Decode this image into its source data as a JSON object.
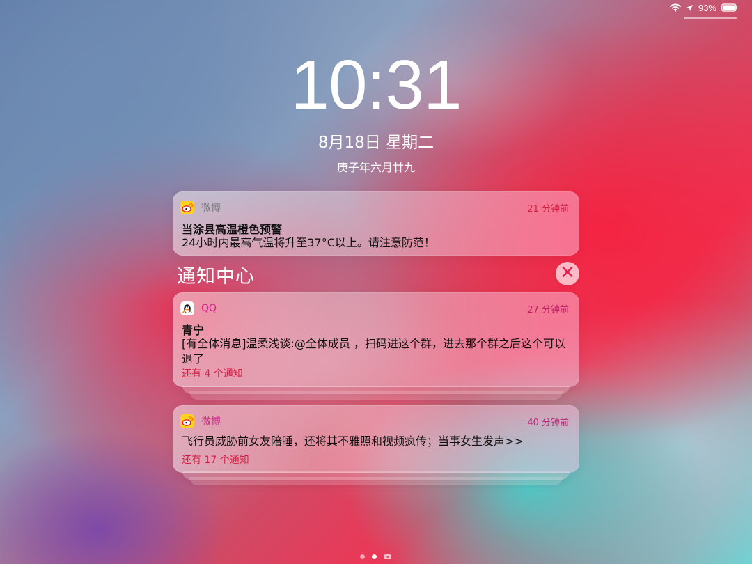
{
  "status": {
    "battery_percent": "93%"
  },
  "lock_screen": {
    "time": "10:31",
    "date": "8月18日 星期二",
    "lunar_date": "庚子年六月廿九"
  },
  "notification_center": {
    "title": "通知中心",
    "clear_label": "✕"
  },
  "notifications": [
    {
      "app": "微博",
      "time": "21 分钟前",
      "title": "当涂县高温橙色预警",
      "body": "24小时内最高气温将升至37°C以上。请注意防范！",
      "icon": "weibo-icon"
    },
    {
      "app": "QQ",
      "time": "27 分钟前",
      "title": "青宁",
      "body": "[有全体消息]温柔浅谈:@全体成员 ，扫码进这个群，进去那个群之后这个可以退了",
      "more": "还有 4 个通知",
      "icon": "qq-icon"
    },
    {
      "app": "微博",
      "time": "40 分钟前",
      "body": "飞行员威胁前女友陪睡，还将其不雅照和视频疯传；当事女生发声>>",
      "more": "还有 17 个通知",
      "icon": "weibo-icon"
    }
  ],
  "colors": {
    "accent_red": "#e21d4f",
    "accent_magenta": "#d0248a"
  },
  "icons": {
    "wifi": "wifi-icon",
    "location": "location-arrow-icon",
    "battery": "battery-icon",
    "close": "close-icon",
    "camera": "camera-icon"
  }
}
